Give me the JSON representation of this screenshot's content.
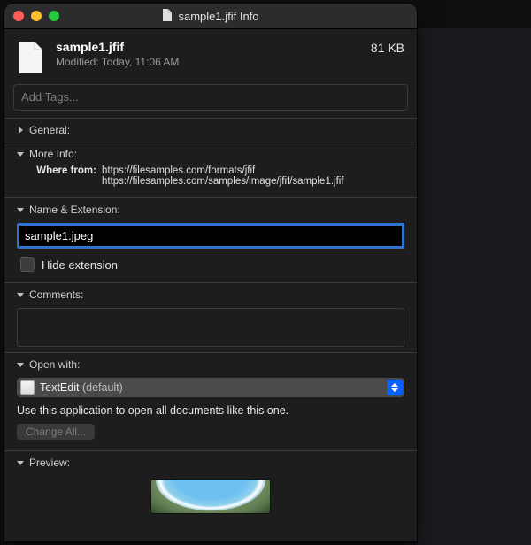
{
  "window": {
    "title": "sample1.jfif Info"
  },
  "file": {
    "name": "sample1.jfif",
    "modified": "Modified: Today, 11:06 AM",
    "size": "81 KB"
  },
  "tags": {
    "placeholder": "Add Tags..."
  },
  "sections": {
    "general": "General:",
    "moreinfo": "More Info:",
    "nameext": "Name & Extension:",
    "comments": "Comments:",
    "openwith": "Open with:",
    "preview": "Preview:"
  },
  "more_info": {
    "where_label": "Where from:",
    "where_values": [
      "https://filesamples.com/formats/jfif",
      "https://filesamples.com/samples/image/jfif/sample1.jfif"
    ]
  },
  "name_ext": {
    "value": "sample1.jpeg",
    "hide_ext_label": "Hide extension"
  },
  "open_with": {
    "app": "TextEdit",
    "default_suffix": "(default)",
    "desc": "Use this application to open all documents like this one.",
    "change_all": "Change All..."
  }
}
